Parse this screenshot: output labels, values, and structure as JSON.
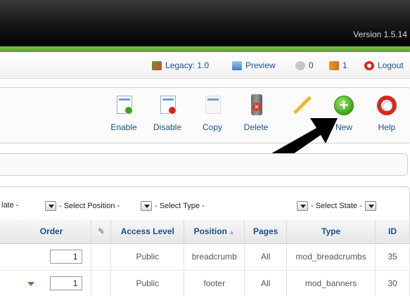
{
  "header": {
    "version": "Version 1.5.14"
  },
  "status": {
    "legacy": "Legacy: 1.0",
    "preview": "Preview",
    "messages": "0",
    "users": "1",
    "logout": "Logout"
  },
  "toolbar": [
    {
      "label": "Enable",
      "icon": "enable-icon"
    },
    {
      "label": "Disable",
      "icon": "disable-icon"
    },
    {
      "label": "Copy",
      "icon": "copy-icon"
    },
    {
      "label": "Delete",
      "icon": "delete-icon"
    },
    {
      "label": "Edit",
      "icon": "edit-icon"
    },
    {
      "label": "New",
      "icon": "new-icon"
    },
    {
      "label": "Help",
      "icon": "help-icon"
    }
  ],
  "filters": {
    "template": "late -",
    "position": "- Select Position -",
    "type": "- Select Type -",
    "state": "- Select State -"
  },
  "grid": {
    "columns": [
      "Order",
      "",
      "Access Level",
      "Position",
      "Pages",
      "Type",
      "ID"
    ],
    "rows": [
      {
        "order": "1",
        "access": "Public",
        "position": "breadcrumb",
        "pages": "All",
        "type": "mod_breadcrumbs",
        "id": "35"
      },
      {
        "order": "1",
        "access": "Public",
        "position": "footer",
        "pages": "All",
        "type": "mod_banners",
        "id": "30"
      }
    ]
  },
  "colors": {
    "accent_green": "#5aa02c",
    "link_blue": "#1a4f8b",
    "public_green": "#2f9f1f"
  }
}
